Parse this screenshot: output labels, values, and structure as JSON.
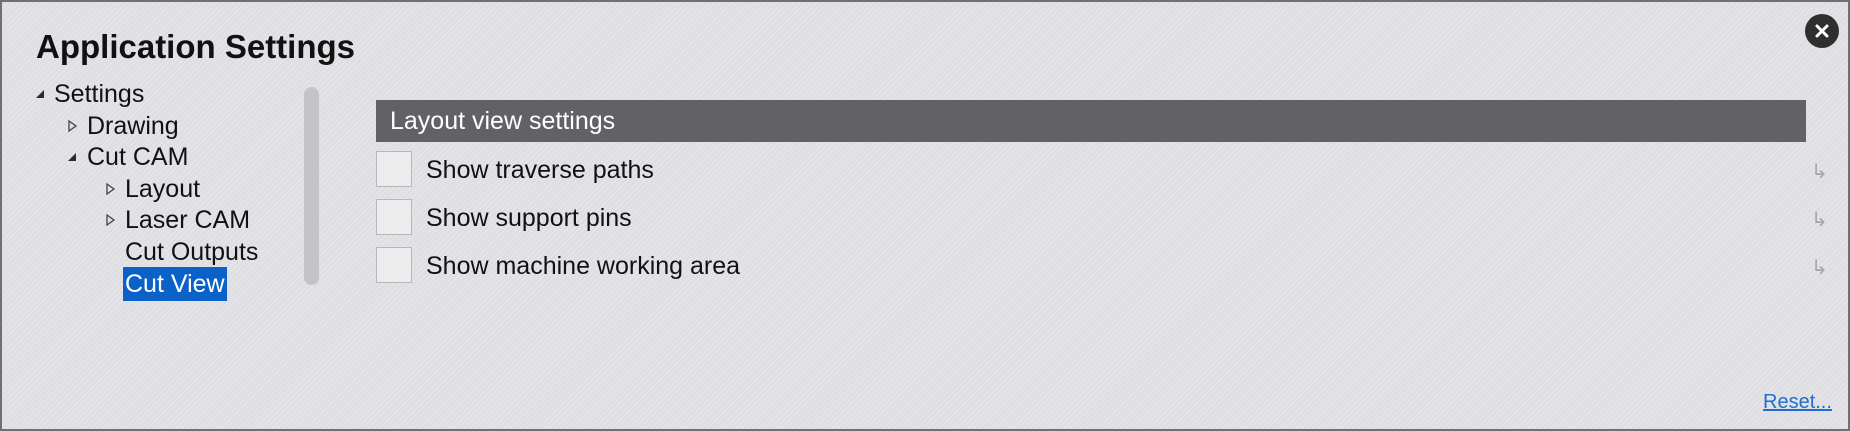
{
  "window": {
    "title": "Application Settings"
  },
  "tree": {
    "items": [
      {
        "label": "Settings",
        "state": "expanded"
      },
      {
        "label": "Drawing",
        "state": "collapsed"
      },
      {
        "label": "Cut CAM",
        "state": "expanded"
      },
      {
        "label": "Layout",
        "state": "collapsed"
      },
      {
        "label": "Laser CAM",
        "state": "collapsed"
      },
      {
        "label": "Cut Outputs",
        "state": "leaf"
      },
      {
        "label": "Cut View",
        "state": "leaf",
        "selected": true
      }
    ]
  },
  "section": {
    "title": "Layout view settings"
  },
  "settings": [
    {
      "label": "Show traverse paths",
      "checked": false,
      "reset_glyph": "↳"
    },
    {
      "label": "Show support pins",
      "checked": false,
      "reset_glyph": "↳"
    },
    {
      "label": "Show machine working area",
      "checked": false,
      "reset_glyph": "↳"
    }
  ],
  "footer": {
    "reset_label": "Reset..."
  },
  "icons": {
    "close": "close-icon",
    "expanded": "triangle-expanded-icon",
    "collapsed": "triangle-collapsed-icon"
  },
  "colors": {
    "selection": "#0a62c9",
    "section_header": "#626266",
    "link": "#1f6fd0"
  }
}
